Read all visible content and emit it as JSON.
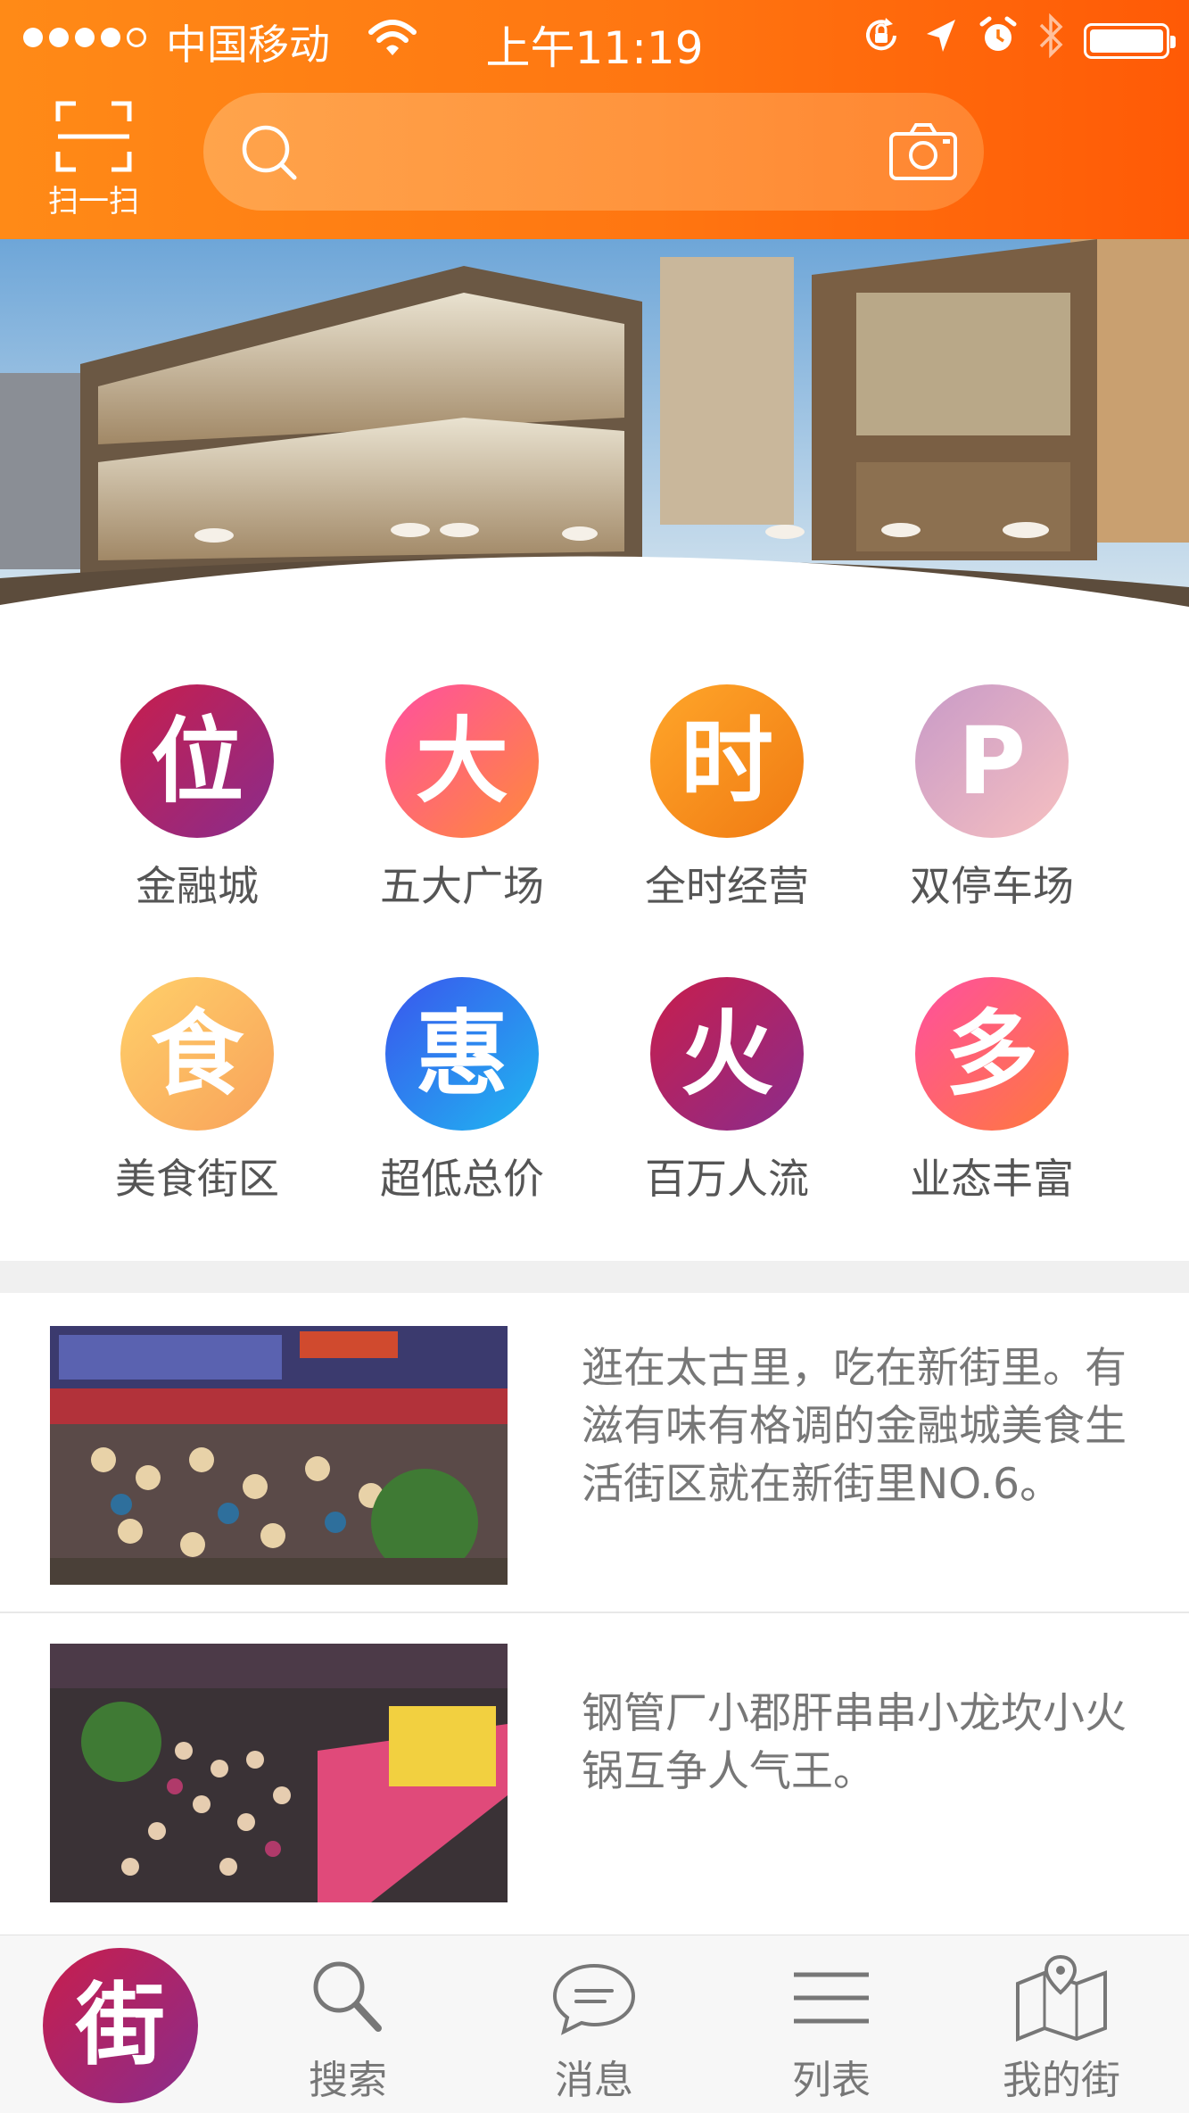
{
  "status_bar": {
    "carrier": "中国移动",
    "time": "上午11:19"
  },
  "header": {
    "scan_label": "扫一扫",
    "search_placeholder": ""
  },
  "categories": [
    {
      "glyph": "位",
      "label": "金融城",
      "color_start": "#c81e4c",
      "color_end": "#8a2c8c"
    },
    {
      "glyph": "大",
      "label": "五大广场",
      "color_start": "#ff4fa0",
      "color_end": "#ff8a3a"
    },
    {
      "glyph": "时",
      "label": "全时经营",
      "color_start": "#ffa62a",
      "color_end": "#f07a12"
    },
    {
      "glyph": "P",
      "label": "双停车场",
      "color_start": "#c89ac8",
      "color_end": "#f7c0c0"
    },
    {
      "glyph": "食",
      "label": "美食街区",
      "color_start": "#ffd06a",
      "color_end": "#f8a25a"
    },
    {
      "glyph": "惠",
      "label": "超低总价",
      "color_start": "#3a55ee",
      "color_end": "#1fb7f0"
    },
    {
      "glyph": "火",
      "label": "百万人流",
      "color_start": "#c81e4c",
      "color_end": "#8a2c8c"
    },
    {
      "glyph": "多",
      "label": "业态丰富",
      "color_start": "#ff4fa0",
      "color_end": "#ff7a3a"
    }
  ],
  "articles": [
    {
      "text": "逛在太古里，吃在新街里。有滋有味有格调的金融城美食生活街区就在新街里NO.6。"
    },
    {
      "text": "钢管厂小郡肝串串小龙坎小火锅互争人气王。"
    }
  ],
  "tabbar": {
    "home_glyph": "街",
    "tabs": [
      {
        "label": "搜索",
        "icon": "search-icon"
      },
      {
        "label": "消息",
        "icon": "message-icon"
      },
      {
        "label": "列表",
        "icon": "list-icon"
      },
      {
        "label": "我的街",
        "icon": "map-icon"
      }
    ]
  },
  "colors": {
    "header_start": "#ff8a17",
    "header_end": "#ff5a06",
    "text_gray": "#777777"
  }
}
